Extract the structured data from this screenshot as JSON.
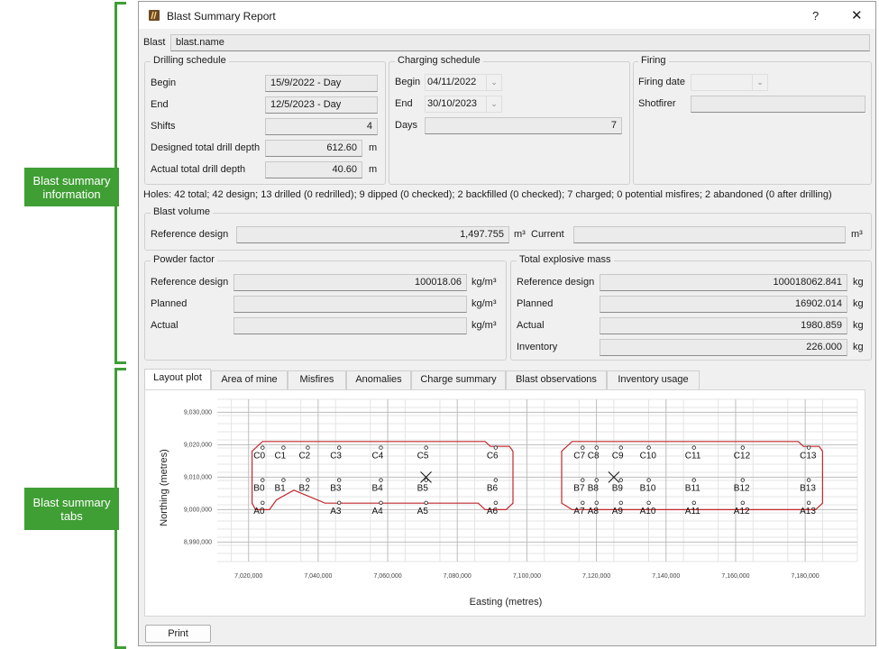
{
  "annotations": {
    "info_label": "Blast summary information",
    "tabs_label": "Blast summary tabs",
    "accent": "#3f9e34"
  },
  "window": {
    "title": "Blast Summary Report",
    "help_glyph": "?",
    "close_glyph": "✕",
    "icon": "blast-app-icon"
  },
  "blast": {
    "label": "Blast",
    "value": "blast.name"
  },
  "drilling": {
    "title": "Drilling schedule",
    "begin_label": "Begin",
    "begin": "15/9/2022 - Day",
    "end_label": "End",
    "end": "12/5/2023 - Day",
    "shifts_label": "Shifts",
    "shifts": "4",
    "designed_label": "Designed total drill depth",
    "designed": "612.60",
    "designed_unit": "m",
    "actual_label": "Actual total drill depth",
    "actual": "40.60",
    "actual_unit": "m"
  },
  "charging": {
    "title": "Charging schedule",
    "begin_label": "Begin",
    "begin": "04/11/2022",
    "end_label": "End",
    "end": "30/10/2023",
    "days_label": "Days",
    "days": "7"
  },
  "firing": {
    "title": "Firing",
    "date_label": "Firing date",
    "date": "",
    "shotfirer_label": "Shotfirer",
    "shotfirer": ""
  },
  "holes_summary": "Holes: 42 total; 42 design; 13 drilled (0 redrilled); 9 dipped (0 checked); 2 backfilled (0 checked); 7 charged; 0 potential misfires; 2 abandoned (0 after drilling)",
  "blast_volume": {
    "title": "Blast volume",
    "reference_label": "Reference design",
    "reference": "1,497.755",
    "reference_unit": "m³",
    "current_label": "Current",
    "current": "",
    "current_unit": "m³"
  },
  "powder_factor": {
    "title": "Powder factor",
    "reference_label": "Reference design",
    "reference": "100018.06",
    "planned_label": "Planned",
    "planned": "",
    "actual_label": "Actual",
    "actual": "",
    "unit": "kg/m³"
  },
  "explosive_mass": {
    "title": "Total explosive mass",
    "reference_label": "Reference design",
    "reference": "100018062.841",
    "planned_label": "Planned",
    "planned": "16902.014",
    "actual_label": "Actual",
    "actual": "1980.859",
    "inventory_label": "Inventory",
    "inventory": "226.000",
    "unit": "kg"
  },
  "tabs": [
    "Layout plot",
    "Area of mine",
    "Misfires",
    "Anomalies",
    "Charge summary",
    "Blast observations",
    "Inventory usage"
  ],
  "active_tab": 0,
  "print_label": "Print",
  "chart_data": {
    "type": "scatter",
    "xlabel": "Easting (metres)",
    "ylabel": "Northing (metres)",
    "xlim": [
      7011000,
      7195000
    ],
    "ylim": [
      8984000,
      9034000
    ],
    "xticks": [
      7020000,
      7040000,
      7060000,
      7080000,
      7100000,
      7120000,
      7140000,
      7160000,
      7180000
    ],
    "xtick_labels": [
      "7,020,000",
      "7,040,000",
      "7,060,000",
      "7,080,000",
      "7,100,000",
      "7,120,000",
      "7,140,000",
      "7,160,000",
      "7,180,000"
    ],
    "yticks": [
      8990000,
      9000000,
      9010000,
      9020000,
      9030000
    ],
    "ytick_labels": [
      "8,990,000",
      "9,000,000",
      "9,010,000",
      "9,020,000",
      "9,030,000"
    ],
    "grid": true,
    "boundary_color": "#c0282d",
    "rows": [
      {
        "y": 9000000,
        "label_dy": -1
      },
      {
        "y": 9010000,
        "label_dy": 0
      },
      {
        "y": 9020000,
        "label_dy": 0
      }
    ],
    "holes": [
      {
        "label": "A0",
        "x": 7023000,
        "y": 9001000
      },
      {
        "label": "A3",
        "x": 7045000,
        "y": 9001000
      },
      {
        "label": "A4",
        "x": 7057000,
        "y": 9001000
      },
      {
        "label": "A5",
        "x": 7070000,
        "y": 9001000
      },
      {
        "label": "A6",
        "x": 7090000,
        "y": 9001000
      },
      {
        "label": "B0",
        "x": 7023000,
        "y": 9008000
      },
      {
        "label": "B1",
        "x": 7029000,
        "y": 9008000
      },
      {
        "label": "B2",
        "x": 7036000,
        "y": 9008000
      },
      {
        "label": "B3",
        "x": 7045000,
        "y": 9008000
      },
      {
        "label": "B4",
        "x": 7057000,
        "y": 9008000
      },
      {
        "label": "B5",
        "x": 7070000,
        "y": 9008000
      },
      {
        "label": "B6",
        "x": 7090000,
        "y": 9008000
      },
      {
        "label": "C0",
        "x": 7023000,
        "y": 9018000
      },
      {
        "label": "C1",
        "x": 7029000,
        "y": 9018000
      },
      {
        "label": "C2",
        "x": 7036000,
        "y": 9018000
      },
      {
        "label": "C3",
        "x": 7045000,
        "y": 9018000
      },
      {
        "label": "C4",
        "x": 7057000,
        "y": 9018000
      },
      {
        "label": "C5",
        "x": 7070000,
        "y": 9018000
      },
      {
        "label": "C6",
        "x": 7090000,
        "y": 9018000
      },
      {
        "label": "A7",
        "x": 7115000,
        "y": 9001000
      },
      {
        "label": "A8",
        "x": 7119000,
        "y": 9001000
      },
      {
        "label": "A9",
        "x": 7126000,
        "y": 9001000
      },
      {
        "label": "A10",
        "x": 7134000,
        "y": 9001000
      },
      {
        "label": "A11",
        "x": 7147000,
        "y": 9001000
      },
      {
        "label": "A12",
        "x": 7161000,
        "y": 9001000
      },
      {
        "label": "A13",
        "x": 7180000,
        "y": 9001000
      },
      {
        "label": "B7",
        "x": 7115000,
        "y": 9008000
      },
      {
        "label": "B8",
        "x": 7119000,
        "y": 9008000
      },
      {
        "label": "B9",
        "x": 7126000,
        "y": 9008000
      },
      {
        "label": "B10",
        "x": 7134000,
        "y": 9008000
      },
      {
        "label": "B11",
        "x": 7147000,
        "y": 9008000
      },
      {
        "label": "B12",
        "x": 7161000,
        "y": 9008000
      },
      {
        "label": "B13",
        "x": 7180000,
        "y": 9008000
      },
      {
        "label": "C7",
        "x": 7115000,
        "y": 9018000
      },
      {
        "label": "C8",
        "x": 7119000,
        "y": 9018000
      },
      {
        "label": "C9",
        "x": 7126000,
        "y": 9018000
      },
      {
        "label": "C10",
        "x": 7134000,
        "y": 9018000
      },
      {
        "label": "C11",
        "x": 7147000,
        "y": 9018000
      },
      {
        "label": "C12",
        "x": 7161000,
        "y": 9018000
      },
      {
        "label": "C13",
        "x": 7180000,
        "y": 9018000
      }
    ],
    "crosses": [
      {
        "x": 7071000,
        "y": 9010000
      },
      {
        "x": 7125000,
        "y": 9010000
      }
    ]
  }
}
